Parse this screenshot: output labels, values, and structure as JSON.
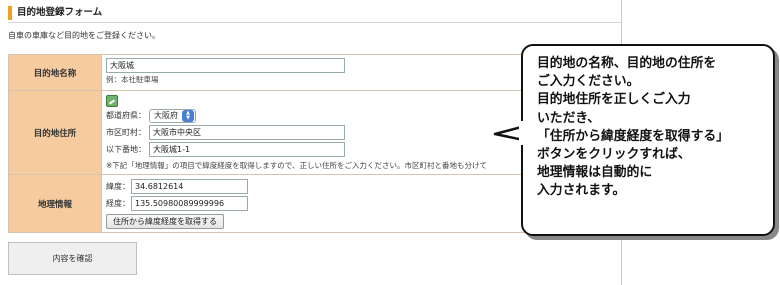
{
  "form": {
    "title": "目的地登録フォーム",
    "intro": "自車の車庫など目的地をご登録ください。"
  },
  "rows": {
    "name": {
      "label": "目的地名称",
      "value": "大阪城",
      "example": "例：本社駐車場"
    },
    "address": {
      "label": "目的地住所",
      "pref_label": "都道府県：",
      "pref_value": "大阪府",
      "city_label": "市区町村：",
      "city_value": "大阪市中央区",
      "street_label": "以下番地：",
      "street_value": "大阪城1-1",
      "note": "※下記「地理情報」の項目で緯度経度を取得しますので、正しい住所をご入力ください。市区町村と番地も分けて"
    },
    "geo": {
      "label": "地理情報",
      "lat_label": "緯度：",
      "lat_value": "34.6812614",
      "lng_label": "経度：",
      "lng_value": "135.50980089999996",
      "button_label": "住所から緯度経度を取得する"
    }
  },
  "confirm_button": "内容を確認",
  "bubble": {
    "lines": [
      "目的地の名称、目的地の住所を",
      "ご入力ください。",
      "目的地住所を正しくご入力",
      "いただき、",
      "「住所から緯度経度を取得する」",
      "ボタンをクリックすれば、",
      "地理情報は自動的に",
      "入力されます。"
    ]
  },
  "colors": {
    "accent": "#f0a21c",
    "header_cell": "#f6cb9f"
  },
  "icons": {
    "map": "map-icon",
    "select_arrows": "up-down-arrows-icon"
  }
}
